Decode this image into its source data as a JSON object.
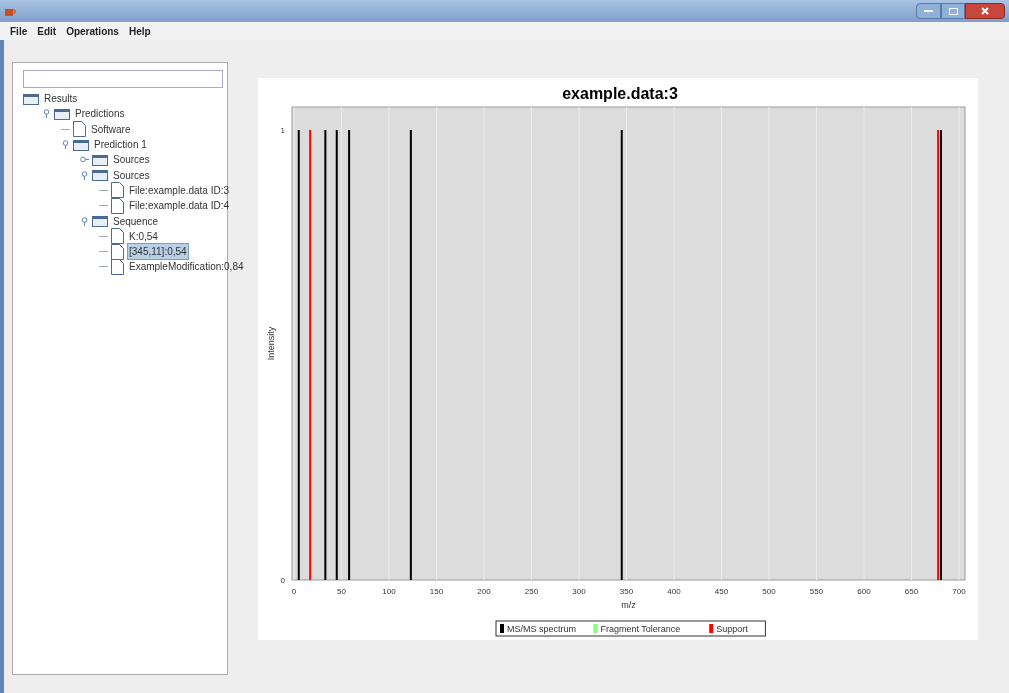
{
  "menu": [
    "File",
    "Edit",
    "Operations",
    "Help"
  ],
  "tree": [
    {
      "label": "Results",
      "kind": "folder",
      "selected": false,
      "children": [
        {
          "label": "Predictions",
          "kind": "folder",
          "expanded": true,
          "selected": false,
          "children": [
            {
              "label": "Software",
              "kind": "file",
              "selected": false
            },
            {
              "label": "Prediction 1",
              "kind": "folder",
              "expanded": true,
              "selected": false,
              "children": [
                {
                  "label": "Sources",
                  "kind": "folder",
                  "expanded": false,
                  "selected": false
                },
                {
                  "label": "Sources",
                  "kind": "folder",
                  "expanded": true,
                  "selected": false,
                  "children": [
                    {
                      "label": "File:example.data ID:3",
                      "kind": "file",
                      "selected": false
                    },
                    {
                      "label": "File:example.data ID:4",
                      "kind": "file",
                      "selected": false
                    }
                  ]
                },
                {
                  "label": "Sequence",
                  "kind": "folder",
                  "expanded": true,
                  "selected": false,
                  "children": [
                    {
                      "label": "K:0,54",
                      "kind": "file",
                      "selected": false
                    },
                    {
                      "label": "[345,11]:0,54",
                      "kind": "file",
                      "selected": true
                    },
                    {
                      "label": "ExampleModification:0,84",
                      "kind": "file",
                      "selected": false
                    }
                  ]
                }
              ]
            }
          ]
        }
      ]
    }
  ],
  "chart_data": {
    "type": "bar",
    "title": "example.data:3",
    "xlabel": "m/z",
    "ylabel": "Intensity",
    "x": [
      5,
      17,
      33,
      45,
      58,
      123,
      345,
      678,
      681
    ],
    "series": [
      {
        "name": "MS/MS spectrum",
        "color": "#000000",
        "values": [
          1,
          null,
          1,
          1,
          1,
          1,
          1,
          null,
          1
        ]
      },
      {
        "name": "Fragment Tolerance",
        "color": "#80ff80",
        "values": [
          null,
          null,
          null,
          null,
          null,
          null,
          null,
          null,
          null
        ]
      },
      {
        "name": "Support",
        "color": "#ff0000",
        "values": [
          null,
          1,
          null,
          null,
          null,
          null,
          null,
          1,
          null
        ]
      }
    ],
    "grid": true,
    "legend": true,
    "xlim": [
      0,
      700
    ],
    "ylim": [
      0,
      1
    ],
    "xticks": [
      0,
      50,
      100,
      150,
      200,
      250,
      300,
      350,
      400,
      450,
      500,
      550,
      600,
      650,
      700
    ],
    "yticks": [
      0,
      1
    ]
  }
}
